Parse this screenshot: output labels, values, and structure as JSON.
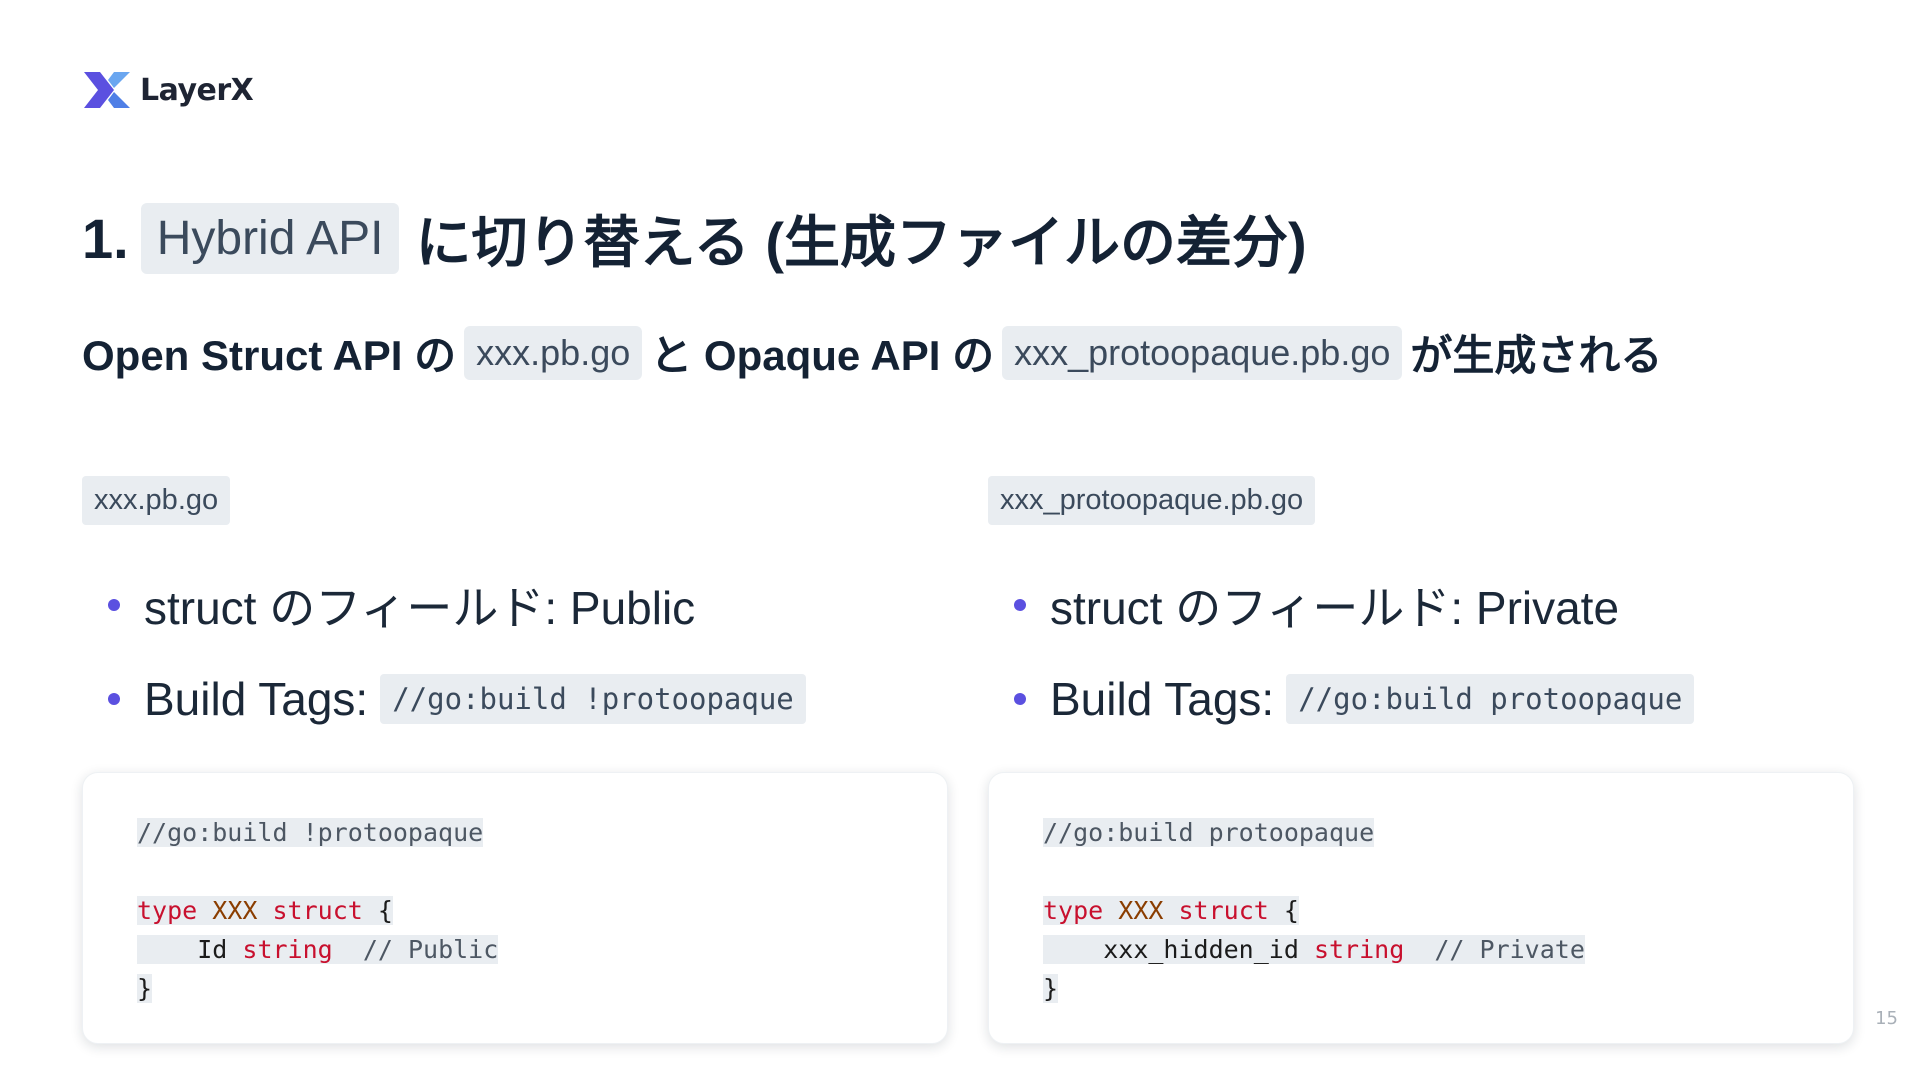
{
  "logo": {
    "name": "LayerX"
  },
  "title": {
    "prefix": "1.",
    "chip": "Hybrid API",
    "suffix": "に切り替える (生成ファイルの差分)"
  },
  "subtitle": {
    "part1": "Open Struct API の",
    "chip1": "xxx.pb.go",
    "part2": "と Opaque API の",
    "chip2": "xxx_protoopaque.pb.go",
    "part3": "が生成される"
  },
  "left": {
    "file": "xxx.pb.go",
    "bullet1": "struct のフィールド: Public",
    "bullet2_label": "Build Tags:",
    "bullet2_code": "//go:build !protoopaque",
    "code": {
      "directive": "//go:build !protoopaque",
      "kw_type": "type",
      "type_name": "XXX",
      "kw_struct": "struct",
      "open_brace": "{",
      "field_name": "Id",
      "field_type": "string",
      "comment": "// Public",
      "close_brace": "}"
    }
  },
  "right": {
    "file": "xxx_protoopaque.pb.go",
    "bullet1": "struct のフィールド: Private",
    "bullet2_label": "Build Tags:",
    "bullet2_code": "//go:build protoopaque",
    "code": {
      "directive": "//go:build protoopaque",
      "kw_type": "type",
      "type_name": "XXX",
      "kw_struct": "struct",
      "open_brace": "{",
      "field_name": "xxx_hidden_id",
      "field_type": "string",
      "comment": "// Private",
      "close_brace": "}"
    }
  },
  "page_number": "15",
  "colors": {
    "bullet": "#5b50e0",
    "keyword": "#c8102e",
    "type_name": "#8a3d00",
    "chip_bg": "#e9edf1"
  }
}
